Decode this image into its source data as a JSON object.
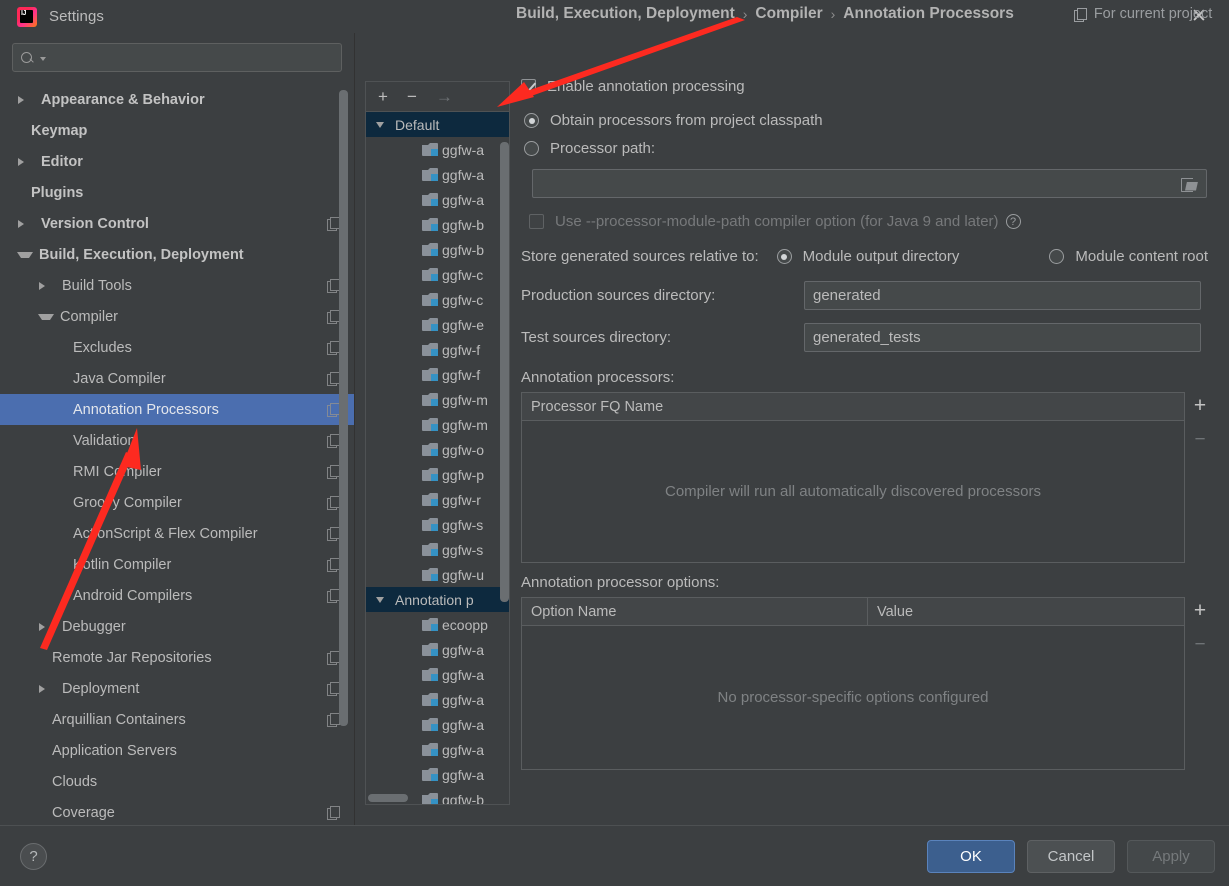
{
  "window": {
    "title": "Settings",
    "logo_text": "IJ",
    "close_icon": "✕"
  },
  "sidebar": {
    "search": {
      "value": "",
      "placeholder": ""
    },
    "items": [
      {
        "label": "Appearance & Behavior",
        "twisty": "right",
        "indent": 0,
        "bold": true,
        "project_icon": false,
        "selected": false
      },
      {
        "label": "Keymap",
        "twisty": "none",
        "indent": 0,
        "bold": true,
        "project_icon": false,
        "selected": false
      },
      {
        "label": "Editor",
        "twisty": "right",
        "indent": 0,
        "bold": true,
        "project_icon": false,
        "selected": false
      },
      {
        "label": "Plugins",
        "twisty": "none",
        "indent": 0,
        "bold": true,
        "project_icon": false,
        "selected": false
      },
      {
        "label": "Version Control",
        "twisty": "right",
        "indent": 0,
        "bold": true,
        "project_icon": true,
        "selected": false
      },
      {
        "label": "Build, Execution, Deployment",
        "twisty": "down",
        "indent": 0,
        "bold": true,
        "project_icon": false,
        "selected": false
      },
      {
        "label": "Build Tools",
        "twisty": "right",
        "indent": 1,
        "bold": false,
        "project_icon": true,
        "selected": false
      },
      {
        "label": "Compiler",
        "twisty": "down",
        "indent": 1,
        "bold": false,
        "project_icon": true,
        "selected": false
      },
      {
        "label": "Excludes",
        "twisty": "none",
        "indent": 2,
        "bold": false,
        "project_icon": true,
        "selected": false
      },
      {
        "label": "Java Compiler",
        "twisty": "none",
        "indent": 2,
        "bold": false,
        "project_icon": true,
        "selected": false
      },
      {
        "label": "Annotation Processors",
        "twisty": "none",
        "indent": 2,
        "bold": false,
        "project_icon": true,
        "selected": true
      },
      {
        "label": "Validation",
        "twisty": "none",
        "indent": 2,
        "bold": false,
        "project_icon": true,
        "selected": false
      },
      {
        "label": "RMI Compiler",
        "twisty": "none",
        "indent": 2,
        "bold": false,
        "project_icon": true,
        "selected": false
      },
      {
        "label": "Groovy Compiler",
        "twisty": "none",
        "indent": 2,
        "bold": false,
        "project_icon": true,
        "selected": false
      },
      {
        "label": "ActionScript & Flex Compiler",
        "twisty": "none",
        "indent": 2,
        "bold": false,
        "project_icon": true,
        "selected": false
      },
      {
        "label": "Kotlin Compiler",
        "twisty": "none",
        "indent": 2,
        "bold": false,
        "project_icon": true,
        "selected": false
      },
      {
        "label": "Android Compilers",
        "twisty": "none",
        "indent": 2,
        "bold": false,
        "project_icon": true,
        "selected": false
      },
      {
        "label": "Debugger",
        "twisty": "right",
        "indent": 1,
        "bold": false,
        "project_icon": false,
        "selected": false
      },
      {
        "label": "Remote Jar Repositories",
        "twisty": "none",
        "indent": 1,
        "bold": false,
        "project_icon": true,
        "selected": false
      },
      {
        "label": "Deployment",
        "twisty": "right",
        "indent": 1,
        "bold": false,
        "project_icon": true,
        "selected": false
      },
      {
        "label": "Arquillian Containers",
        "twisty": "none",
        "indent": 1,
        "bold": false,
        "project_icon": true,
        "selected": false
      },
      {
        "label": "Application Servers",
        "twisty": "none",
        "indent": 1,
        "bold": false,
        "project_icon": false,
        "selected": false
      },
      {
        "label": "Clouds",
        "twisty": "none",
        "indent": 1,
        "bold": false,
        "project_icon": false,
        "selected": false
      },
      {
        "label": "Coverage",
        "twisty": "none",
        "indent": 1,
        "bold": false,
        "project_icon": true,
        "selected": false
      }
    ]
  },
  "modules": {
    "toolbar": {
      "add": "+",
      "remove": "−",
      "move": "→"
    },
    "rows": [
      {
        "type": "group",
        "label": "Default",
        "selected": true
      },
      {
        "type": "module",
        "label": "ggfw-a"
      },
      {
        "type": "module",
        "label": "ggfw-a"
      },
      {
        "type": "module",
        "label": "ggfw-a"
      },
      {
        "type": "module",
        "label": "ggfw-b"
      },
      {
        "type": "module",
        "label": "ggfw-b"
      },
      {
        "type": "module",
        "label": "ggfw-c"
      },
      {
        "type": "module",
        "label": "ggfw-c"
      },
      {
        "type": "module",
        "label": "ggfw-e"
      },
      {
        "type": "module",
        "label": "ggfw-f"
      },
      {
        "type": "module",
        "label": "ggfw-f"
      },
      {
        "type": "module",
        "label": "ggfw-m"
      },
      {
        "type": "module",
        "label": "ggfw-m"
      },
      {
        "type": "module",
        "label": "ggfw-o"
      },
      {
        "type": "module",
        "label": "ggfw-p"
      },
      {
        "type": "module",
        "label": "ggfw-r"
      },
      {
        "type": "module",
        "label": "ggfw-s"
      },
      {
        "type": "module",
        "label": "ggfw-s"
      },
      {
        "type": "module",
        "label": "ggfw-u"
      },
      {
        "type": "group",
        "label": "Annotation p",
        "selected": false
      },
      {
        "type": "module",
        "label": "ecoopp"
      },
      {
        "type": "module",
        "label": "ggfw-a"
      },
      {
        "type": "module",
        "label": "ggfw-a"
      },
      {
        "type": "module",
        "label": "ggfw-a"
      },
      {
        "type": "module",
        "label": "ggfw-a"
      },
      {
        "type": "module",
        "label": "ggfw-a"
      },
      {
        "type": "module",
        "label": "ggfw-a"
      },
      {
        "type": "module",
        "label": "ggfw-b"
      }
    ]
  },
  "main": {
    "breadcrumbs": [
      "Build, Execution, Deployment",
      "Compiler",
      "Annotation Processors"
    ],
    "breadcrumb_separator": "›",
    "for_current_project": "For current project",
    "enable_annotation_processing": {
      "label": "Enable annotation processing",
      "checked": true
    },
    "processor_source": {
      "options": [
        {
          "label": "Obtain processors from project classpath",
          "selected": true
        },
        {
          "label": "Processor path:",
          "selected": false
        }
      ],
      "path_value": "",
      "folder_icon": "folder-open-icon"
    },
    "processor_module_path": {
      "label": "Use --processor-module-path compiler option (for Java 9 and later)",
      "checked": false,
      "help_glyph": "?"
    },
    "store_generated": {
      "label": "Store generated sources relative to:",
      "options": [
        {
          "label": "Module output directory",
          "selected": true
        },
        {
          "label": "Module content root",
          "selected": false
        }
      ]
    },
    "production_sources": {
      "label": "Production sources directory:",
      "value": "generated"
    },
    "test_sources": {
      "label": "Test sources directory:",
      "value": "generated_tests"
    },
    "processors_table": {
      "label": "Annotation processors:",
      "columns": [
        "Processor FQ Name"
      ],
      "rows": [],
      "empty_text": "Compiler will run all automatically discovered processors",
      "add_glyph": "+",
      "remove_glyph": "−"
    },
    "options_table": {
      "label": "Annotation processor options:",
      "columns": [
        "Option Name",
        "Value"
      ],
      "rows": [],
      "empty_text": "No processor-specific options configured",
      "add_glyph": "+",
      "remove_glyph": "−"
    }
  },
  "footer": {
    "help_glyph": "?",
    "ok": "OK",
    "cancel": "Cancel",
    "apply": "Apply"
  },
  "colors": {
    "background": "#3c3f41",
    "selection": "#4b6eaf",
    "group_selection": "#0d293e",
    "primary_button": "#3c5f8e",
    "module_badge": "#3592c4",
    "annotation_arrow": "#fd2a20"
  }
}
